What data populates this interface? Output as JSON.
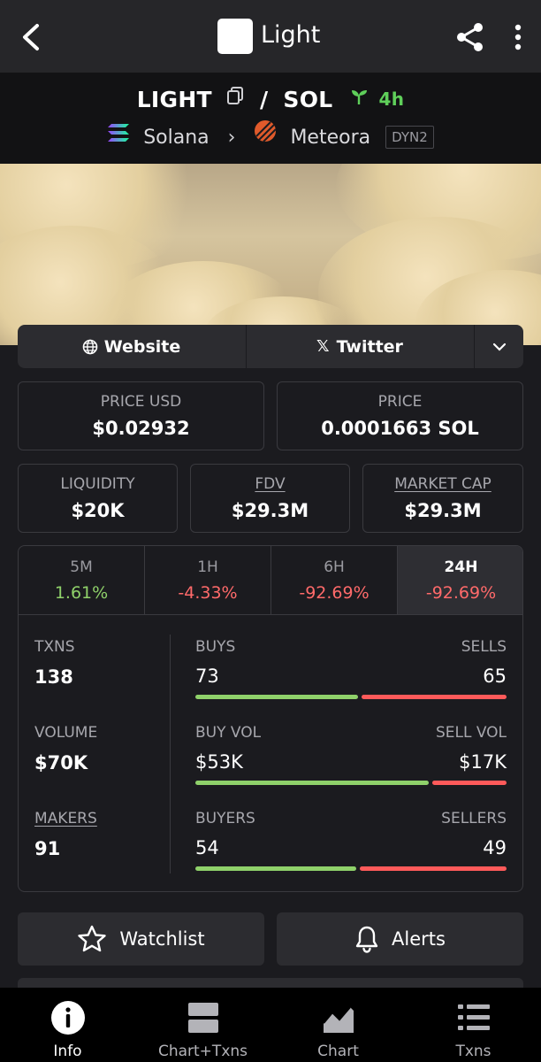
{
  "topbar": {
    "title": "Light"
  },
  "pair": {
    "base": "LIGHT",
    "separator": "/",
    "quote": "SOL",
    "age": "4h",
    "chain": "Solana",
    "dex": "Meteora",
    "pool_type": "DYN2"
  },
  "links": {
    "website": "Website",
    "twitter": "Twitter"
  },
  "stats": {
    "price_usd_label": "PRICE USD",
    "price_usd": "$0.02932",
    "price_label": "PRICE",
    "price": "0.0001663 SOL",
    "liquidity_label": "LIQUIDITY",
    "liquidity": "$20K",
    "fdv_label": "FDV",
    "fdv": "$29.3M",
    "mcap_label": "MARKET CAP",
    "mcap": "$29.3M"
  },
  "timeframes": [
    {
      "label": "5M",
      "change": "1.61%",
      "direction": "up"
    },
    {
      "label": "1H",
      "change": "-4.33%",
      "direction": "down"
    },
    {
      "label": "6H",
      "change": "-92.69%",
      "direction": "down"
    },
    {
      "label": "24H",
      "change": "-92.69%",
      "direction": "down",
      "active": true
    }
  ],
  "metrics": {
    "txns_label": "TXNS",
    "txns": "138",
    "volume_label": "VOLUME",
    "volume": "$70K",
    "makers_label": "MAKERS",
    "makers": "91",
    "buys_label": "BUYS",
    "buys": "73",
    "sells_label": "SELLS",
    "sells": "65",
    "buy_vol_label": "BUY VOL",
    "buy_vol": "$53K",
    "sell_vol_label": "SELL VOL",
    "sell_vol": "$17K",
    "buyers_label": "BUYERS",
    "buyers": "54",
    "sellers_label": "SELLERS",
    "sellers": "49",
    "buy_share": 0.529,
    "buy_vol_share": 0.757,
    "buyer_share": 0.524
  },
  "actions": {
    "watchlist": "Watchlist",
    "alerts": "Alerts"
  },
  "nav": [
    {
      "label": "Info",
      "icon": "info-icon",
      "active": true
    },
    {
      "label": "Chart+Txns",
      "icon": "split-view-icon"
    },
    {
      "label": "Chart",
      "icon": "chart-icon"
    },
    {
      "label": "Txns",
      "icon": "list-icon"
    }
  ],
  "colors": {
    "positive": "#8fd16a",
    "negative": "#ff6a6a",
    "age": "#5fcf5a"
  }
}
